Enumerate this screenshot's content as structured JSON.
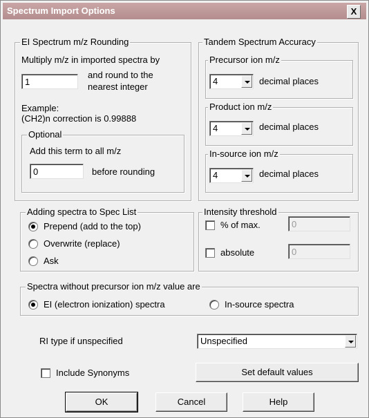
{
  "window": {
    "title": "Spectrum Import Options",
    "close_label": "X"
  },
  "ei_rounding": {
    "group_label": "EI Spectrum m/z Rounding",
    "multiply_label": "Multiply m/z in imported spectra by",
    "multiplier_value": "1",
    "round_label_1": "and round to the",
    "round_label_2": "nearest integer",
    "example_1": "Example:",
    "example_2": "(CH2)n correction is 0.99888",
    "optional_label": "Optional",
    "add_term_label": "Add this term to all m/z",
    "add_term_value": "0",
    "before_rounding_label": "before rounding"
  },
  "tandem": {
    "group_label": "Tandem Spectrum Accuracy",
    "precursor_label": "Precursor ion m/z",
    "precursor_value": "4",
    "product_label": "Product ion m/z",
    "product_value": "4",
    "insource_label": "In-source ion m/z",
    "insource_value": "4",
    "decimal_label": "decimal places"
  },
  "adding": {
    "group_label": "Adding spectra to Spec List",
    "options": [
      {
        "label": "Prepend (add to the top)",
        "selected": true
      },
      {
        "label": "Overwrite (replace)",
        "selected": false
      },
      {
        "label": "Ask",
        "selected": false
      }
    ]
  },
  "intensity": {
    "group_label": "Intensity threshold",
    "percent_label": "% of max.",
    "percent_checked": false,
    "percent_value": "0",
    "absolute_label": "absolute",
    "absolute_checked": false,
    "absolute_value": "0"
  },
  "precursorless": {
    "group_label": "Spectra without precursor ion m/z value are",
    "options": [
      {
        "label": "EI (electron ionization) spectra",
        "selected": true
      },
      {
        "label": "In-source spectra",
        "selected": false
      }
    ]
  },
  "ri_type": {
    "label": "RI type if unspecified",
    "value": "Unspecified"
  },
  "synonyms": {
    "label": "Include Synonyms",
    "checked": false
  },
  "buttons": {
    "set_default": "Set default values",
    "ok": "OK",
    "cancel": "Cancel",
    "help": "Help"
  }
}
